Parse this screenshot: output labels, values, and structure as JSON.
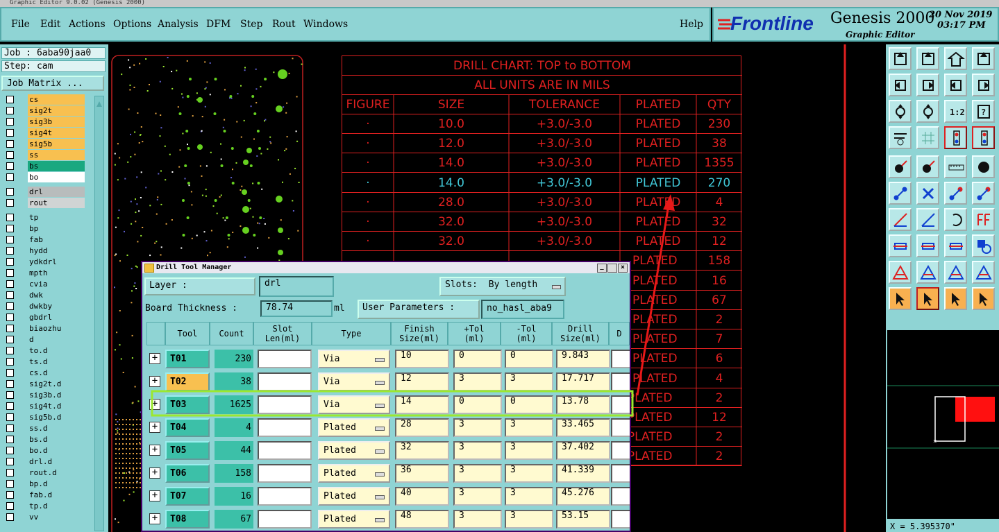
{
  "window": {
    "title": "Graphic Editor 9.0.02 (Genesis 2000)"
  },
  "menu": {
    "file": "File",
    "edit": "Edit",
    "actions": "Actions",
    "options": "Options",
    "analysis": "Analysis",
    "dfm": "DFM",
    "step": "Step",
    "rout": "Rout",
    "windows": "Windows",
    "help": "Help"
  },
  "brand": {
    "logo": "Frontline",
    "product": "Genesis 2000",
    "subtitle": "Graphic Editor",
    "date": "20 Nov 2019",
    "time": "03:17 PM"
  },
  "left": {
    "job": "Job : 6aba90jaa0",
    "step": "Step: cam",
    "matrix_button": "Job Matrix ...",
    "group1": [
      {
        "name": "cs",
        "color": "#f8c050"
      },
      {
        "name": "sig2t",
        "color": "#f8c050"
      },
      {
        "name": "sig3b",
        "color": "#f8c050"
      },
      {
        "name": "sig4t",
        "color": "#f8c050"
      },
      {
        "name": "sig5b",
        "color": "#f8c050"
      },
      {
        "name": "ss",
        "color": "#f8c050"
      },
      {
        "name": "bs",
        "color": "#1aa880"
      },
      {
        "name": "bo",
        "color": "#ffffff"
      }
    ],
    "group2": [
      {
        "name": "drl",
        "color": "#b8bcbc"
      },
      {
        "name": "rout",
        "color": "#d0d4d4"
      }
    ],
    "group3": [
      {
        "name": "tp",
        "mark": ""
      },
      {
        "name": "bp",
        "mark": ""
      },
      {
        "name": "fab",
        "mark": "✎"
      },
      {
        "name": "hydd",
        "mark": ""
      },
      {
        "name": "ydkdrl",
        "mark": ""
      },
      {
        "name": "mpth",
        "mark": ""
      },
      {
        "name": "cvia",
        "mark": ""
      },
      {
        "name": "dwk",
        "mark": ""
      },
      {
        "name": "dwkby",
        "mark": ""
      },
      {
        "name": "gbdrl",
        "mark": ""
      },
      {
        "name": "biaozhu",
        "mark": ""
      },
      {
        "name": "d",
        "mark": ""
      },
      {
        "name": "to.d",
        "mark": "✎"
      },
      {
        "name": "ts.d",
        "mark": ""
      },
      {
        "name": "cs.d",
        "mark": ""
      },
      {
        "name": "sig2t.d",
        "mark": ""
      },
      {
        "name": "sig3b.d",
        "mark": ""
      },
      {
        "name": "sig4t.d",
        "mark": ""
      },
      {
        "name": "sig5b.d",
        "mark": ""
      },
      {
        "name": "ss.d",
        "mark": ""
      },
      {
        "name": "bs.d",
        "mark": ""
      },
      {
        "name": "bo.d",
        "mark": ""
      },
      {
        "name": "drl.d",
        "mark": ""
      },
      {
        "name": "rout.d",
        "mark": ""
      },
      {
        "name": "bp.d",
        "mark": ""
      },
      {
        "name": "fab.d",
        "mark": "✎"
      },
      {
        "name": "tp.d",
        "mark": ""
      },
      {
        "name": "vv",
        "mark": ""
      }
    ]
  },
  "drill_chart": {
    "title": "DRILL CHART: TOP to BOTTOM",
    "units": "ALL UNITS ARE IN MILS",
    "headers": {
      "figure": "FIGURE",
      "size": "SIZE",
      "tolerance": "TOLERANCE",
      "plated": "PLATED",
      "qty": "QTY"
    },
    "rows": [
      {
        "figure": "·",
        "size": "10.0",
        "tol": "+3.0/-3.0",
        "plated": "PLATED",
        "qty": "230"
      },
      {
        "figure": "·",
        "size": "12.0",
        "tol": "+3.0/-3.0",
        "plated": "PLATED",
        "qty": "38"
      },
      {
        "figure": "·",
        "size": "14.0",
        "tol": "+3.0/-3.0",
        "plated": "PLATED",
        "qty": "1355"
      },
      {
        "figure": "·",
        "size": "14.0",
        "tol": "+3.0/-3.0",
        "plated": "PLATED",
        "qty": "270"
      },
      {
        "figure": "·",
        "size": "28.0",
        "tol": "+3.0/-3.0",
        "plated": "PLATED",
        "qty": "4"
      },
      {
        "figure": "·",
        "size": "32.0",
        "tol": "+3.0/-3.0",
        "plated": "PLATED",
        "qty": "32"
      },
      {
        "figure": "·",
        "size": "32.0",
        "tol": "+3.0/-3.0",
        "plated": "PLATED",
        "qty": "12"
      },
      {
        "figure": "",
        "size": "",
        "tol": "",
        "plated": "PLATED",
        "qty": "158"
      },
      {
        "figure": "",
        "size": "",
        "tol": "",
        "plated": "PLATED",
        "qty": "16"
      },
      {
        "figure": "",
        "size": "",
        "tol": "",
        "plated": "PLATED",
        "qty": "67"
      },
      {
        "figure": "",
        "size": "",
        "tol": "",
        "plated": "PLATED",
        "qty": "2"
      },
      {
        "figure": "",
        "size": "",
        "tol": "",
        "plated": "PLATED",
        "qty": "7"
      },
      {
        "figure": "",
        "size": "",
        "tol": "",
        "plated": "PLATED",
        "qty": "6"
      },
      {
        "figure": "",
        "size": "",
        "tol": "",
        "plated": "PLATED",
        "qty": "4"
      },
      {
        "figure": "",
        "size": "",
        "tol": "",
        "plated": "N-PLATED",
        "qty": "2"
      },
      {
        "figure": "",
        "size": "",
        "tol": "",
        "plated": "N-PLATED",
        "qty": "12"
      },
      {
        "figure": "",
        "size": "",
        "tol": "",
        "plated": "N-PLATED",
        "qty": "2"
      },
      {
        "figure": "",
        "size": "",
        "tol": "",
        "plated": "N-PLATED",
        "qty": "2"
      }
    ],
    "colors": {
      "normal": "#e02020",
      "highlight": "#40c8d8"
    }
  },
  "dtm": {
    "title": "Drill Tool Manager",
    "layer_label": "Layer            :",
    "layer_value": "drl",
    "slots_label": "Slots:",
    "slots_value": "By length",
    "thickness_label": "Board Thickness :",
    "thickness_value": "78.74",
    "thickness_unit": "ml",
    "user_params_label": "User Parameters :",
    "user_params_value": "no_hasl_aba9",
    "headers": {
      "tool": "Tool",
      "count": "Count",
      "slot": "Slot\nLen(ml)",
      "type": "Type",
      "finish": "Finish\nSize(ml)",
      "ptol": "+Tol\n(ml)",
      "mtol": "-Tol\n(ml)",
      "drill": "Drill\nSize(ml)",
      "d": "D"
    },
    "rows": [
      {
        "tool": "T01",
        "count": "230",
        "type": "Via",
        "finish": "10",
        "ptol": "0",
        "mtol": "0",
        "drill": "9.843"
      },
      {
        "tool": "T02",
        "count": "38",
        "type": "Via",
        "finish": "12",
        "ptol": "3",
        "mtol": "3",
        "drill": "17.717"
      },
      {
        "tool": "T03",
        "count": "1625",
        "type": "Via",
        "finish": "14",
        "ptol": "0",
        "mtol": "0",
        "drill": "13.78"
      },
      {
        "tool": "T04",
        "count": "4",
        "type": "Plated",
        "finish": "28",
        "ptol": "3",
        "mtol": "3",
        "drill": "33.465"
      },
      {
        "tool": "T05",
        "count": "44",
        "type": "Plated",
        "finish": "32",
        "ptol": "3",
        "mtol": "3",
        "drill": "37.402"
      },
      {
        "tool": "T06",
        "count": "158",
        "type": "Plated",
        "finish": "36",
        "ptol": "3",
        "mtol": "3",
        "drill": "41.339"
      },
      {
        "tool": "T07",
        "count": "16",
        "type": "Plated",
        "finish": "40",
        "ptol": "3",
        "mtol": "3",
        "drill": "45.276"
      },
      {
        "tool": "T08",
        "count": "67",
        "type": "Plated",
        "finish": "48",
        "ptol": "3",
        "mtol": "3",
        "drill": "53.15"
      }
    ],
    "selected_tool": "T02"
  },
  "status": {
    "coord": "X = 5.395370\""
  },
  "colors": {
    "panel": "#8fd4d4",
    "annotation_green": "#9be830",
    "annotation_red": "#e81818"
  }
}
